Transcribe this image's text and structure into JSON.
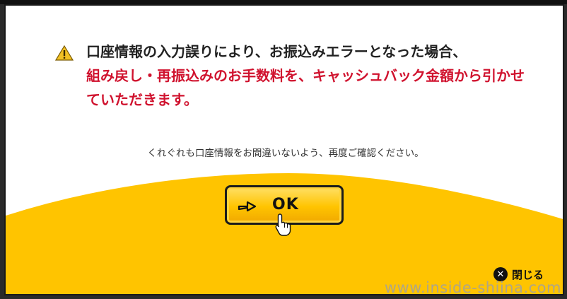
{
  "dialog": {
    "message_line1": "口座情報の入力誤りにより、お振込みエラーとなった場合、",
    "message_red": "組み戻し・再振込みのお手数料を、キャッシュバック金額から引かせていただきます。",
    "sub_message": "くれぐれも口座情報をお間違いないよう、再度ご確認ください。",
    "ok_label": "OK",
    "close_label": "閉じる"
  },
  "watermark": "www.inside-shiina.com",
  "icons": {
    "warning": "warning-icon",
    "ok_arrow": "arrow-right-icon",
    "cursor": "hand-cursor-icon",
    "close": "close-icon"
  },
  "colors": {
    "accent_yellow": "#ffc400",
    "red_text": "#d0122e"
  }
}
